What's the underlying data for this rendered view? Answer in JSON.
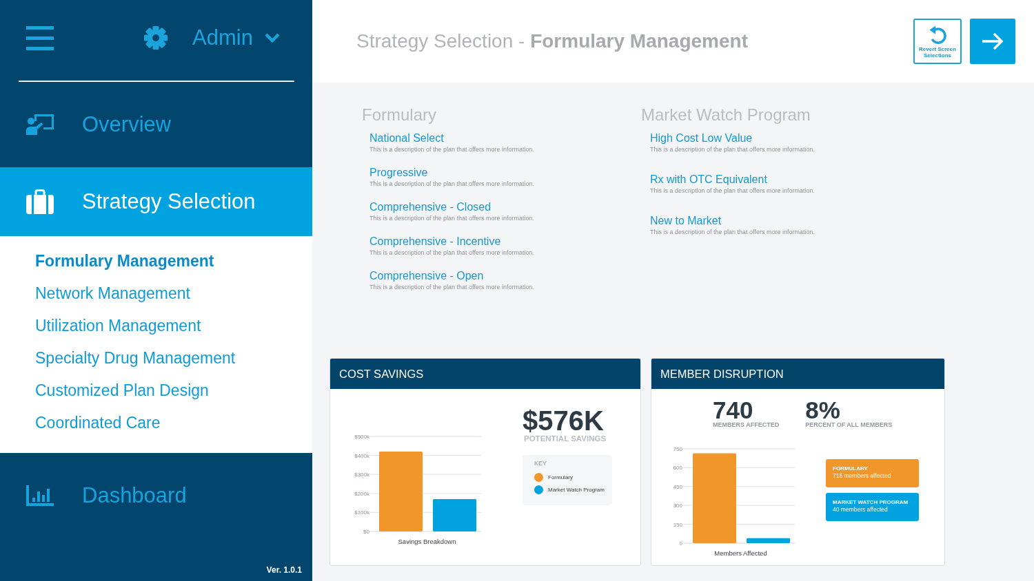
{
  "sidebar": {
    "user": "Admin",
    "nav": [
      {
        "label": "Overview",
        "selected": false
      },
      {
        "label": "Strategy Selection",
        "selected": true,
        "children": [
          {
            "label": "Formulary Management",
            "selected": true
          },
          {
            "label": "Network Management",
            "selected": false
          },
          {
            "label": "Utilization Management",
            "selected": false
          },
          {
            "label": "Specialty Drug Management",
            "selected": false
          },
          {
            "label": "Customized Plan Design",
            "selected": false
          },
          {
            "label": "Coordinated Care",
            "selected": false
          }
        ]
      },
      {
        "label": "Dashboard",
        "selected": false
      }
    ],
    "version": "Ver. 1.0.1"
  },
  "header": {
    "title": "Strategy Selection - **Formulary Management**",
    "actions": [
      {
        "kind": "revert",
        "label": "Revert Screen Selections"
      },
      {
        "kind": "next"
      }
    ]
  },
  "plan_groups": [
    {
      "title": "Formulary",
      "plans": [
        {
          "name": "National Select",
          "description": "This is a description of the plan that offers more information."
        },
        {
          "name": "Progressive",
          "description": "This is a description of the plan that offers more information."
        },
        {
          "name": "Comprehensive - Closed",
          "description": "This is a description of the plan that offers more information."
        },
        {
          "name": "Comprehensive - Incentive",
          "description": "This is a description of the plan that offers more information."
        },
        {
          "name": "Comprehensive - Open",
          "description": "This is a description of the plan that offers more information."
        }
      ]
    },
    {
      "title": "Market Watch Program",
      "plans": [
        {
          "name": "High Cost Low Value",
          "description": "This is a description of the plan that offers more information."
        },
        {
          "name": "Rx with OTC Equivalent",
          "description": "This is a description of the plan that offers more information."
        },
        {
          "name": "New to Market",
          "description": "This is a description of the plan that offers more information."
        }
      ]
    }
  ],
  "cost_savings": {
    "title": "COST SAVINGS",
    "total": "$576K",
    "total_label": "POTENTIAL SAVINGS",
    "chart_data": [
      {
        "type": "bar",
        "xlabel": "Savings Breakdown",
        "categories": [
          null,
          null
        ],
        "values": [
          420000,
          170000
        ],
        "colors": [
          "#f0962a",
          "#00a3e0"
        ],
        "ylim": [
          0,
          500000
        ],
        "yticks": [
          {
            "value": 0,
            "label": "$0"
          },
          {
            "value": 100000,
            "label": "$100k"
          },
          {
            "value": 200000,
            "label": "$200k"
          },
          {
            "value": 300000,
            "label": "$300k"
          },
          {
            "value": 400000,
            "label": "$400k"
          },
          {
            "value": 500000,
            "label": "$500k"
          }
        ],
        "grid": true
      }
    ],
    "key": {
      "title": "KEY",
      "items": [
        {
          "label": "Formulary",
          "color": "#f0962a"
        },
        {
          "label": "Market Watch Program",
          "color": "#00a3e0"
        }
      ]
    }
  },
  "member_disruption": {
    "title": "MEMBER DISRUPTION",
    "stats": [
      {
        "value": "740",
        "label": "MEMBERS AFFECTED"
      },
      {
        "value": "8%",
        "label": "PERCENT OF ALL MEMBERS"
      }
    ],
    "chart_data": [
      {
        "type": "bar",
        "xlabel": "Members Affected",
        "categories": [
          null,
          null
        ],
        "values": [
          715,
          40
        ],
        "colors": [
          "#f0962a",
          "#00a3e0"
        ],
        "ylim": [
          0,
          750
        ],
        "yticks": [
          0,
          150,
          300,
          450,
          600,
          750
        ],
        "grid": true
      }
    ],
    "breakdown": [
      {
        "label": "FORMULARY",
        "detail": "715 members affected",
        "color": "#f0962a"
      },
      {
        "label": "MARKET WATCH PROGRAM",
        "detail": "40 members affected",
        "color": "#00a3e0"
      }
    ]
  }
}
